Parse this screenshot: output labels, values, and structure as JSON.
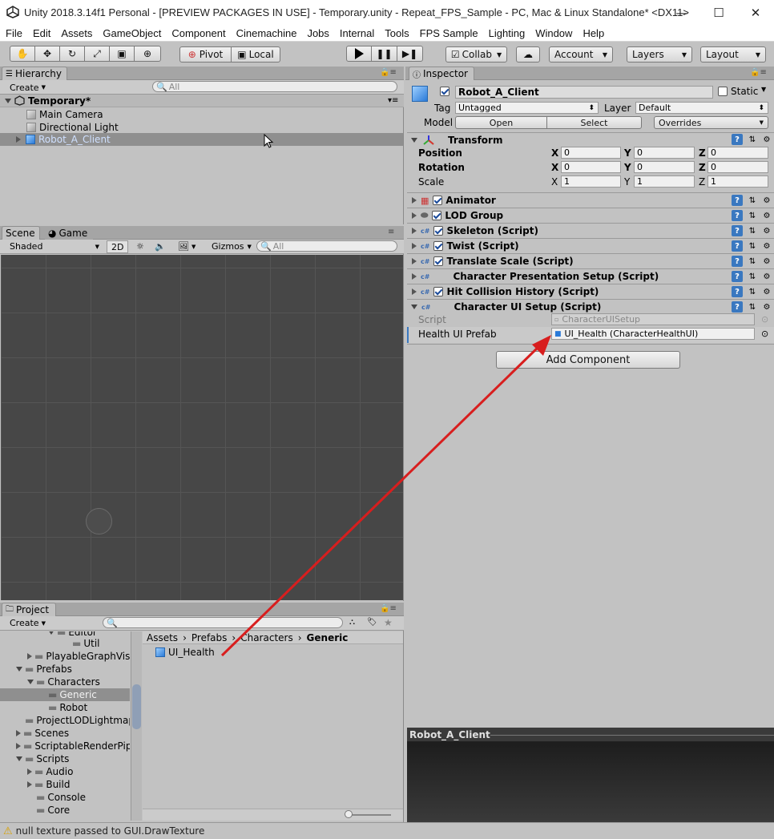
{
  "window": {
    "title": "Unity 2018.3.14f1 Personal - [PREVIEW PACKAGES IN USE] - Temporary.unity - Repeat_FPS_Sample - PC, Mac & Linux Standalone* <DX11>",
    "minimize": "—",
    "maximize": "☐",
    "close": "✕"
  },
  "menu": [
    "File",
    "Edit",
    "Assets",
    "GameObject",
    "Component",
    "Cinemachine",
    "Jobs",
    "Internal",
    "Tools",
    "FPS Sample",
    "Lighting",
    "Window",
    "Help"
  ],
  "toolbar": {
    "pivot": "Pivot",
    "local": "Local",
    "collab": "Collab",
    "account": "Account",
    "layers": "Layers",
    "layout": "Layout"
  },
  "hierarchy": {
    "tab": "Hierarchy",
    "create": "Create",
    "search_placeholder": "All",
    "scene": "Temporary*",
    "items": [
      "Main Camera",
      "Directional Light",
      "Robot_A_Client"
    ]
  },
  "scene": {
    "tab_scene": "Scene",
    "tab_game": "Game",
    "shading": "Shaded",
    "mode2d": "2D",
    "gizmos": "Gizmos",
    "search_placeholder": "All"
  },
  "project": {
    "tab": "Project",
    "create": "Create",
    "breadcrumb": [
      "Assets",
      "Prefabs",
      "Characters",
      "Generic"
    ],
    "tree": [
      "Editor",
      "Util",
      "PlayableGraphVis",
      "Prefabs",
      "Characters",
      "Generic",
      "Robot",
      "ProjectLODLightmap",
      "Scenes",
      "ScriptableRenderPip",
      "Scripts",
      "Audio",
      "Build",
      "Console",
      "Core"
    ],
    "asset": "UI_Health"
  },
  "inspector": {
    "tab": "Inspector",
    "object_name": "Robot_A_Client",
    "static": "Static",
    "tag_label": "Tag",
    "tag": "Untagged",
    "layer_label": "Layer",
    "layer": "Default",
    "model_label": "Model",
    "open": "Open",
    "select": "Select",
    "overrides": "Overrides",
    "transform": {
      "title": "Transform",
      "position": "Position",
      "rotation": "Rotation",
      "scale": "Scale",
      "pos": [
        "0",
        "0",
        "0"
      ],
      "rot": [
        "0",
        "0",
        "0"
      ],
      "scl": [
        "1",
        "1",
        "1"
      ],
      "axes": [
        "X",
        "Y",
        "Z"
      ]
    },
    "components": [
      "Animator",
      "LOD Group",
      "Skeleton (Script)",
      "Twist (Script)",
      "Translate Scale (Script)",
      "Character Presentation Setup (Script)",
      "Hit Collision History (Script)",
      "Character UI Setup (Script)"
    ],
    "script_label": "Script",
    "script_value": "CharacterUISetup",
    "health_label": "Health UI Prefab",
    "health_value": "UI_Health (CharacterHealthUI)",
    "add_component": "Add Component"
  },
  "preview": {
    "title": "Robot_A_Client"
  },
  "status": {
    "message": "null texture passed to GUI.DrawTexture"
  },
  "colors": {
    "accent": "#3a78c0",
    "arrow": "#d81e1e",
    "scene_bg": "#474747"
  }
}
